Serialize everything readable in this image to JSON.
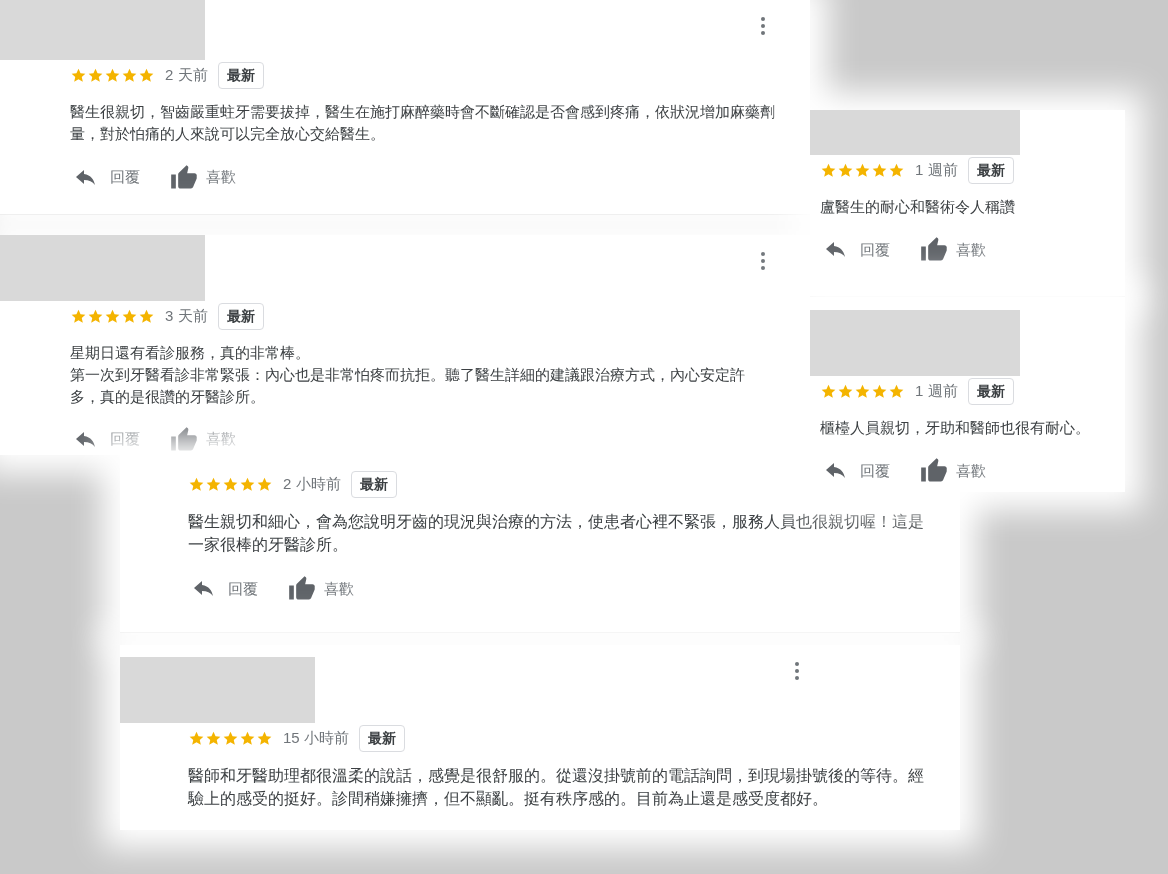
{
  "reviews": [
    {
      "stars": 5,
      "time": "2 天前",
      "badge": "最新",
      "redacted": true,
      "menu": true,
      "paragraphs": [
        "醫生很親切，智齒嚴重蛀牙需要拔掉，醫生在施打麻醉藥時會不斷確認是否會感到疼痛，依狀況增加麻藥劑量，對於怕痛的人來說可以完全放心交給醫生。"
      ],
      "reply": "回覆",
      "like": "喜歡"
    },
    {
      "stars": 5,
      "time": "1 週前",
      "badge": "最新",
      "redacted": true,
      "menu": false,
      "paragraphs": [
        "盧醫生的耐心和醫術令人稱讚"
      ],
      "reply": "回覆",
      "like": "喜歡"
    },
    {
      "stars": 5,
      "time": "3 天前",
      "badge": "最新",
      "redacted": true,
      "menu": true,
      "paragraphs": [
        "星期日還有看診服務，真的非常棒。",
        "第一次到牙醫看診非常緊張：內心也是非常怕疼而抗拒。聽了醫生詳細的建議跟治療方式，內心安定許多，真的是很讚的牙醫診所。"
      ],
      "reply": "回覆",
      "like": "喜歡"
    },
    {
      "stars": 5,
      "time": "1 週前",
      "badge": "最新",
      "redacted": true,
      "menu": false,
      "paragraphs": [
        "櫃檯人員親切，牙助和醫師也很有耐心。"
      ],
      "reply": "回覆",
      "like": "喜歡"
    },
    {
      "stars": 5,
      "time": "2 小時前",
      "badge": "最新",
      "redacted": false,
      "menu": false,
      "paragraphs": [
        "醫生親切和細心，會為您說明牙齒的現況與治療的方法，使患者心裡不緊張，服務人員也很親切喔！這是一家很棒的牙醫診所。"
      ],
      "reply": "回覆",
      "like": "喜歡"
    },
    {
      "stars": 5,
      "time": "15 小時前",
      "badge": "最新",
      "redacted": true,
      "menu": true,
      "paragraphs": [
        "醫師和牙醫助理都很溫柔的說話，感覺是很舒服的。從還沒掛號前的電話詢問，到現場掛號後的等待。經驗上的感受的挺好。診間稍嫌擁擠，但不顯亂。挺有秩序感的。目前為止還是感受度都好。"
      ]
    }
  ]
}
